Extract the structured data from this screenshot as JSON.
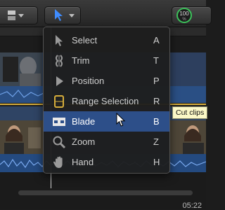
{
  "toolbar": {
    "audio_meter_value": "100",
    "audio_meter_unit": "%"
  },
  "tools_menu": {
    "items": [
      {
        "label": "Select",
        "shortcut": "A",
        "icon": "arrow-select-icon"
      },
      {
        "label": "Trim",
        "shortcut": "T",
        "icon": "trim-icon"
      },
      {
        "label": "Position",
        "shortcut": "P",
        "icon": "position-icon"
      },
      {
        "label": "Range Selection",
        "shortcut": "R",
        "icon": "range-selection-icon"
      },
      {
        "label": "Blade",
        "shortcut": "B",
        "icon": "blade-icon"
      },
      {
        "label": "Zoom",
        "shortcut": "Z",
        "icon": "zoom-icon"
      },
      {
        "label": "Hand",
        "shortcut": "H",
        "icon": "hand-icon"
      }
    ],
    "selected": "Blade"
  },
  "tooltip": "Cut clips",
  "timeline": {
    "timecode": "05:22"
  },
  "colors": {
    "highlight": "#2d4f89",
    "tool_accent": "#3f8cff",
    "range_icon": "#d6ad3b",
    "audio_meter": "#3cc15a"
  }
}
